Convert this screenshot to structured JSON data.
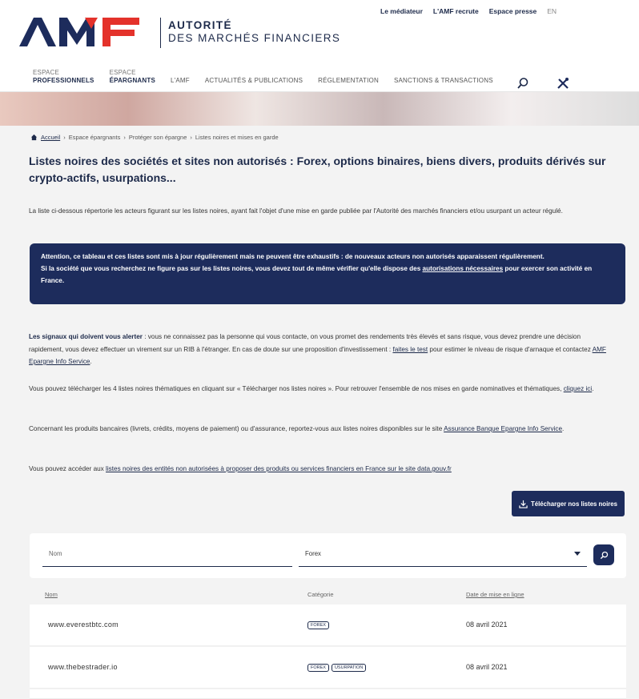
{
  "colors": {
    "primary": "#1d2c5c",
    "brand_red": "#e4322b",
    "background": "#f3f3f3"
  },
  "brand": {
    "line1": "AUTORITÉ",
    "line2": "DES MARCHÉS FINANCIERS"
  },
  "top_links": [
    "Le médiateur",
    "L'AMF recrute",
    "Espace presse",
    "EN"
  ],
  "nav": {
    "pro_small": "ESPACE",
    "pro_strong": "PROFESSIONNELS",
    "epa_small": "ESPACE",
    "epa_strong": "ÉPARGNANTS",
    "items": [
      "L'AMF",
      "ACTUALITÉS & PUBLICATIONS",
      "RÉGLEMENTATION",
      "SANCTIONS & TRANSACTIONS"
    ]
  },
  "breadcrumb": [
    "Accueil",
    "Espace épargnants",
    "Protéger son épargne",
    "Listes noires et mises en garde"
  ],
  "title": "Listes noires des sociétés et sites non autorisés : Forex, options binaires, biens divers, produits dérivés sur crypto-actifs, usurpations...",
  "intro": "La liste ci-dessous répertorie les acteurs figurant sur les listes noires, ayant fait l'objet d'une mise en garde publiée par l'Autorité des marchés financiers et/ou usurpant un acteur régulé.",
  "alert": {
    "line1": "Attention, ce tableau et ces listes sont mis à jour régulièrement mais ne peuvent être exhaustifs : de nouveaux acteurs non autorisés apparaissent régulièrement.",
    "line2_before": "Si la société que vous recherchez ne figure pas sur les listes noires, vous devez tout de même vérifier qu'elle dispose des ",
    "line2_link": "autorisations nécessaires",
    "line2_after": " pour exercer son activité en France."
  },
  "signals": {
    "bold": "Les signaux qui doivent vous alerter",
    "text": " : vous ne connaissez pas la personne qui vous contacte, on vous promet des rendements très élevés et sans risque, vous devez prendre une décision rapidement, vous devez effectuer un virement sur un RIB à l'étranger. En cas de doute sur une proposition d'investissement : ",
    "link1": "faites le test",
    "text2": " pour estimer le niveau de risque d'arnaque et contactez ",
    "link2": "AMF Epargne Info Service",
    "end": "."
  },
  "download_para": {
    "text": "Vous pouvez télécharger les 4 listes noires thématiques en cliquant sur « Télécharger nos listes noires ». Pour retrouver l'ensemble de nos mises en garde nominatives et thématiques, ",
    "link": "cliquez ici",
    "end": "."
  },
  "bank_para": {
    "text": "Concernant les produits bancaires (livrets, crédits, moyens de paiement) ou d'assurance, reportez-vous aux listes noires disponibles sur le site ",
    "link": "Assurance Banque Epargne Info Service",
    "end": "."
  },
  "datagouv_para": {
    "text": "Vous pouvez accéder aux ",
    "link": "listes noires des entités non autorisées à proposer des produits ou services financiers en France sur le site data.gouv.fr"
  },
  "download_button": "Télécharger nos listes noires",
  "search": {
    "name_placeholder": "Nom",
    "category_value": "Forex"
  },
  "table": {
    "headers": [
      "Nom",
      "Catégorie",
      "Date de mise en ligne"
    ],
    "rows": [
      {
        "name": "www.everestbtc.com",
        "tags": [
          "FOREX"
        ],
        "date": "08 avril 2021"
      },
      {
        "name": "www.thebestrader.io",
        "tags": [
          "FOREX",
          "USURPATION"
        ],
        "date": "08 avril 2021"
      }
    ]
  }
}
